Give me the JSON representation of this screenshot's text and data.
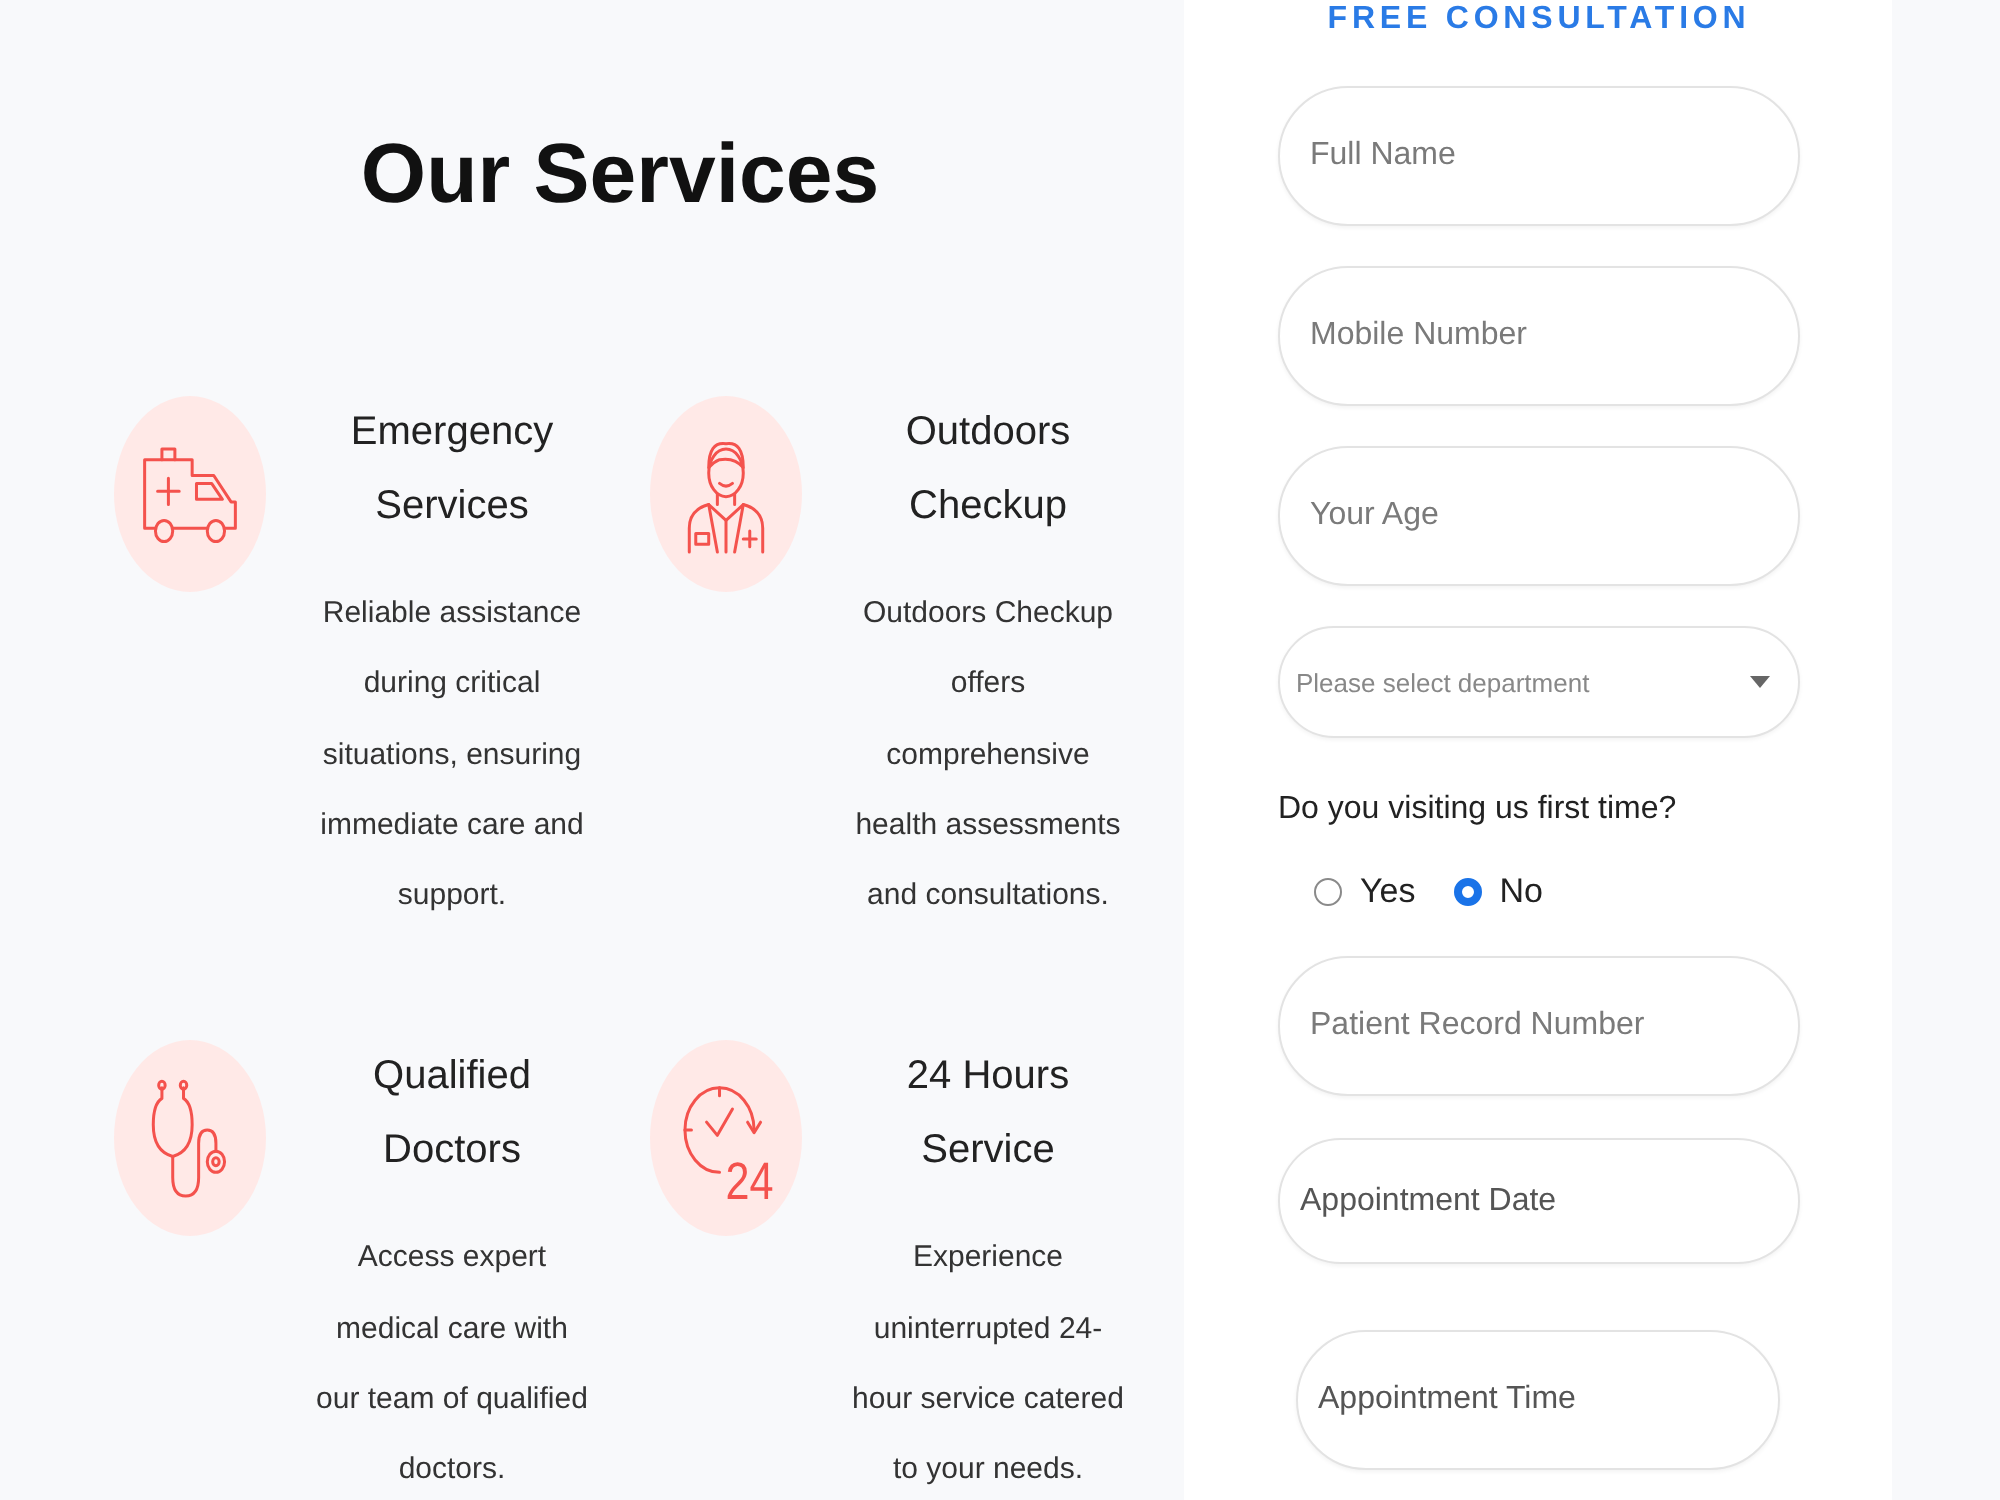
{
  "services": {
    "title": "Our Services",
    "items": [
      {
        "kind": "ambulance",
        "title": "Emergency Services",
        "description": "Reliable assistance during critical situations, ensuring immediate care and support."
      },
      {
        "kind": "doctor",
        "title": "Outdoors Checkup",
        "description": "Outdoors Checkup offers comprehensive health assessments and consultations."
      },
      {
        "kind": "stethoscope",
        "title": "Qualified Doctors",
        "description": "Access expert medical care with our team of qualified doctors."
      },
      {
        "kind": "clock",
        "icon_text": "24",
        "title": "24 Hours Service",
        "description": "Experience uninterrupted 24-hour service catered to your needs."
      }
    ]
  },
  "consultation_form": {
    "title": "FREE CONSULTATION",
    "fields": [
      {
        "kind": "input",
        "placeholder": "Full Name"
      },
      {
        "kind": "input",
        "placeholder": "Mobile Number"
      },
      {
        "kind": "input",
        "placeholder": "Your Age"
      },
      {
        "kind": "select",
        "placeholder": "Please select department"
      },
      {
        "kind": "radio",
        "label": "Do you visiting us first time?",
        "options": [
          {
            "label": "Yes",
            "selected": false
          },
          {
            "label": "No",
            "selected": true
          }
        ]
      },
      {
        "kind": "input",
        "placeholder": "Patient Record Number"
      },
      {
        "kind": "date",
        "placeholder": "Appointment Date"
      },
      {
        "kind": "time",
        "placeholder": "Appointment Time"
      }
    ]
  }
}
